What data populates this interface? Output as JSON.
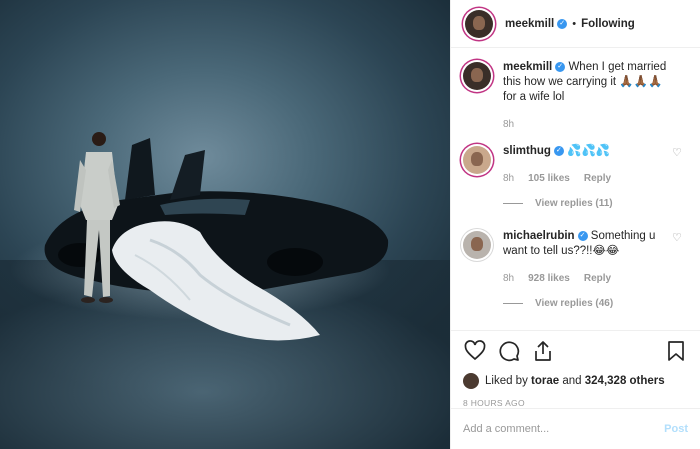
{
  "header": {
    "username": "meekmill",
    "dot": "•",
    "follow_status": "Following"
  },
  "comments": [
    {
      "username": "meekmill",
      "text": "When I get married this how we carrying it 🙏🏾🙏🏾🙏🏾 for a wife lol",
      "time": "8h",
      "likes": "",
      "reply_label": ""
    },
    {
      "username": "slimthug",
      "text": "💦💦💦",
      "time": "8h",
      "likes": "105 likes",
      "reply_label": "Reply",
      "view_replies": "View replies (11)"
    },
    {
      "username": "michaelrubin",
      "text": "Something u want to tell us??!!😂😂",
      "time": "8h",
      "likes": "928 likes",
      "reply_label": "Reply",
      "view_replies": "View replies (46)"
    }
  ],
  "likes": {
    "prefix": "Liked by",
    "user": "torae",
    "conj": "and",
    "others": "324,328 others"
  },
  "timestamp": "8 HOURS AGO",
  "add_comment": {
    "placeholder": "Add a comment...",
    "post_label": "Post"
  },
  "icons": [
    "heart-icon",
    "comment-icon",
    "share-icon",
    "bookmark-icon",
    "verified-icon"
  ],
  "colors": {
    "verified": "#3897f0",
    "post_disabled": "#b2dffc",
    "muted": "#999999"
  }
}
